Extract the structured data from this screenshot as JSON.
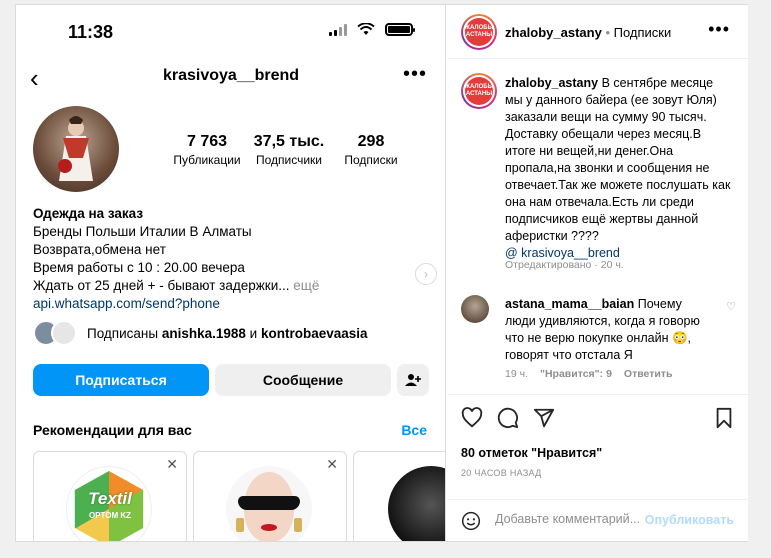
{
  "status_bar": {
    "time": "11:38"
  },
  "profile": {
    "username": "krasivoya__brend",
    "stats": [
      {
        "value": "7 763",
        "label": "Публикации"
      },
      {
        "value": "37,5 тыс.",
        "label": "Подписчики"
      },
      {
        "value": "298",
        "label": "Подписки"
      }
    ],
    "bio": {
      "name": "Одежда на заказ",
      "lines": [
        "Бренды Польши Италии В Алматы",
        "Возврата,обмена нет",
        "Время работы с 10 : 20.00 вечера",
        "Ждать от 25 дней + - бывают задержки..."
      ],
      "more": "ещё",
      "link": "api.whatsapp.com/send?phone"
    },
    "followed_by": {
      "prefix": "Подписаны",
      "user1": "anishka.1988",
      "conj": "и",
      "user2": "kontrobaevaasia"
    },
    "buttons": {
      "follow": "Подписаться",
      "message": "Сообщение"
    },
    "recommendations": {
      "title": "Рекомендации для вас",
      "see_all": "Все",
      "card1_logo_text": "Textil",
      "card1_logo_sub": "OPTOM KZ"
    }
  },
  "post": {
    "author": "zhaloby_astany",
    "author_logo_text": "ЖАЛОБЫ АСТАНЫ",
    "follow_state": "Подписки",
    "caption": "В сентябре месяце мы у данного байера (ее зовут Юля) заказали вещи на сумму 90 тысяч. Доставку обещали через месяц.В итоге ни вещей,ни денег.Она пропала,на звонки и сообщения не отвечает.Так же можете послушать как она нам отвечала.Есть ли среди подписчиков ещё жертвы данной аферистки ????",
    "mention": "@ krasivoya__brend",
    "caption_meta": "Отредактировано · 20 ч.",
    "comment": {
      "user": "astana_mama__baian",
      "text": "Почему люди удивляются, когда я говорю что не верю покупке онлайн 😳, говорят что отстала Я",
      "time": "19 ч.",
      "likes": "\"Нравится\": 9",
      "reply": "Ответить"
    },
    "likes": "80 отметок \"Нравится\"",
    "date": "20 ЧАСОВ НАЗАД",
    "add_comment": {
      "placeholder": "Добавьте комментарий...",
      "publish": "Опубликовать"
    }
  },
  "colors": {
    "accent": "#0095f6",
    "link": "#00376b",
    "muted": "#8e8e8e"
  }
}
